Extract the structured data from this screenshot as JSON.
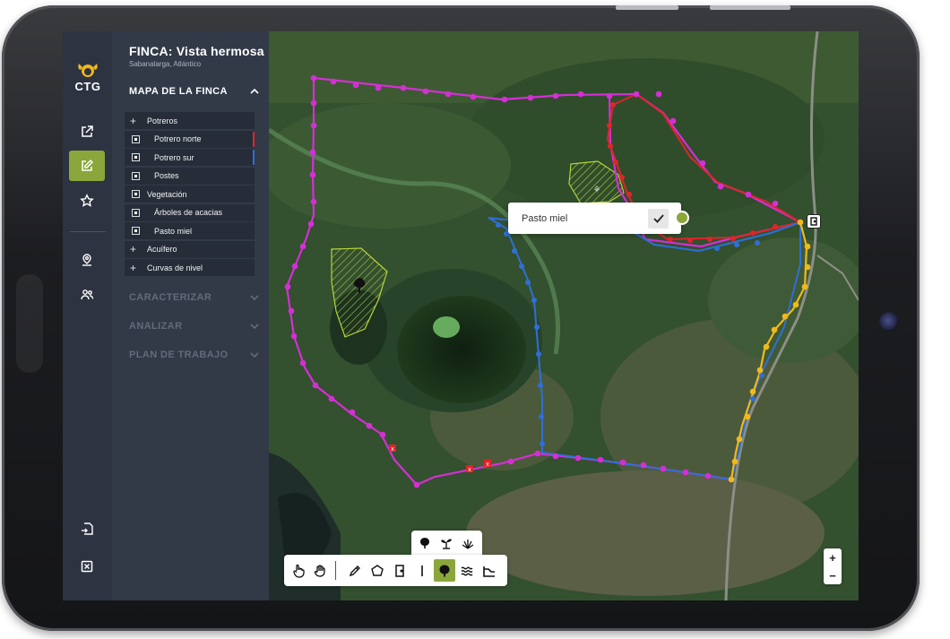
{
  "farm": {
    "title": "FINCA: Vista hermosa",
    "location": "Sabanalarga, Atlántico"
  },
  "brand": {
    "name": "CTG"
  },
  "rail": {
    "items": [
      "external-link-icon",
      "edit-icon",
      "star-icon",
      "location-pin-icon",
      "users-icon",
      "import-icon",
      "close-box-icon"
    ],
    "active_index": 1
  },
  "sections": {
    "map": "MAPA DE LA FINCA",
    "characterize": "CARACTERIZAR",
    "analyze": "ANALIZAR",
    "work_plan": "PLAN DE TRABAJO"
  },
  "layers": [
    {
      "label": "Potreros",
      "kind": "group"
    },
    {
      "label": "Potrero norte",
      "kind": "item",
      "color": "#e0242b"
    },
    {
      "label": "Potrero sur",
      "kind": "item",
      "color": "#2f6fd6"
    },
    {
      "label": "Postes",
      "kind": "item"
    },
    {
      "label": "Vegetación",
      "kind": "group-open"
    },
    {
      "label": "Árboles de acacias",
      "kind": "item"
    },
    {
      "label": "Pasto miel",
      "kind": "item"
    },
    {
      "label": "Acuífero",
      "kind": "group"
    },
    {
      "label": "Curvas de nivel",
      "kind": "group"
    }
  ],
  "popup": {
    "label": "Pasto miel",
    "confirm_icon": "check-icon",
    "color": "#8ba63a"
  },
  "toolbar": {
    "tools": [
      "pointer-hand-icon",
      "grab-hand-icon",
      "pencil-icon",
      "polygon-icon",
      "gate-icon",
      "post-icon",
      "tree-icon",
      "water-icon",
      "slope-icon"
    ],
    "active_tool": "tree-icon",
    "vegetation_tools": [
      "tree-icon",
      "sprout-icon",
      "grass-icon"
    ]
  },
  "zoom": {
    "in": "+",
    "out": "−"
  },
  "colors": {
    "accent": "#8ba63a",
    "farm_boundary": "#d62ed6",
    "north_paddock": "#e0242b",
    "south_paddock": "#2f6fd6",
    "road_boundary": "#f0b91c",
    "vegetation": "#b8d43a"
  }
}
